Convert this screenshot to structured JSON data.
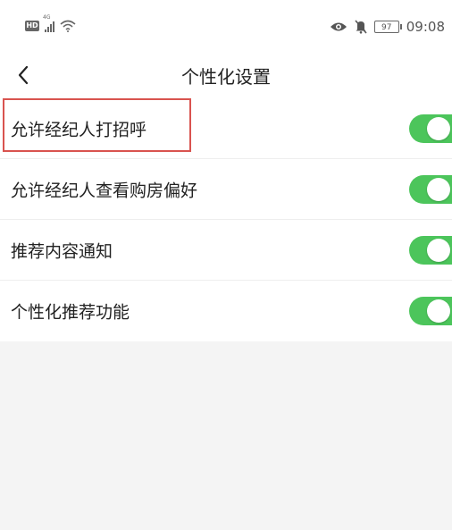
{
  "status_bar": {
    "left_badge": "HD",
    "network": "4G",
    "battery": "97",
    "time": "09:08"
  },
  "nav": {
    "title": "个性化设置"
  },
  "settings": [
    {
      "label": "允许经纪人打招呼",
      "enabled": true,
      "highlighted": true
    },
    {
      "label": "允许经纪人查看购房偏好",
      "enabled": true,
      "highlighted": false
    },
    {
      "label": "推荐内容通知",
      "enabled": true,
      "highlighted": false
    },
    {
      "label": "个性化推荐功能",
      "enabled": true,
      "highlighted": false
    }
  ],
  "colors": {
    "toggle_on": "#4cc55b",
    "highlight_border": "#d9534f",
    "page_background": "#f4f4f4"
  }
}
